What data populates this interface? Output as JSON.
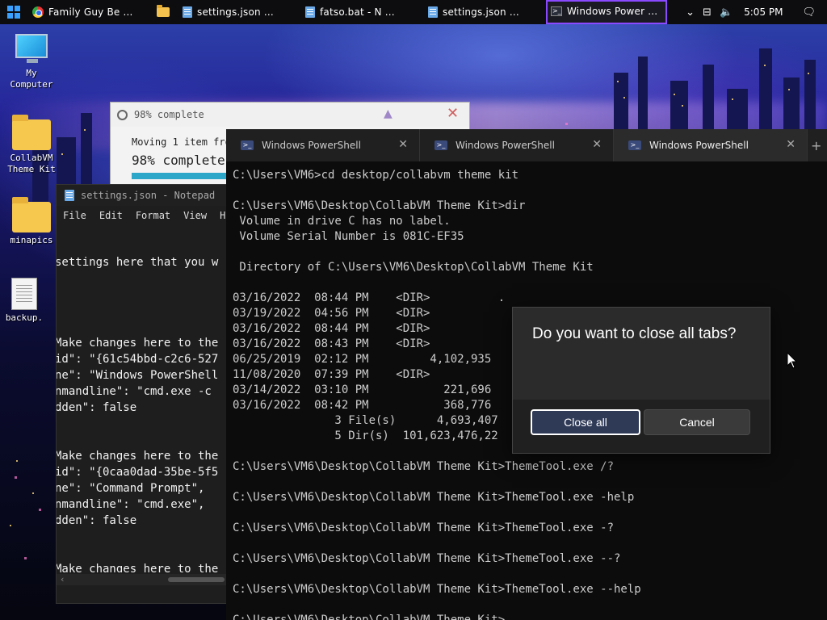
{
  "taskbar": {
    "items": [
      {
        "label": "Family Guy Be ...",
        "icon": "chrome-icon"
      },
      {
        "label": "",
        "icon": "file-explorer-icon"
      },
      {
        "label": "settings.json ...",
        "icon": "notepad-icon"
      },
      {
        "label": "fatso.bat - N ...",
        "icon": "notepad-icon"
      },
      {
        "label": "settings.json ...",
        "icon": "notepad-icon"
      },
      {
        "label": "Windows Power ...",
        "icon": "powershell-icon",
        "active": true
      }
    ],
    "tray": {
      "overflow": "⌄",
      "clock": "5:05 PM"
    }
  },
  "desktop": {
    "icons": [
      {
        "label_lines": [
          "My",
          "Computer"
        ],
        "icon": "my-computer-icon"
      },
      {
        "label_lines": [
          "CollabVM",
          "Theme Kit"
        ],
        "icon": "folder-icon"
      },
      {
        "label_lines": [
          "minapics"
        ],
        "icon": "folder-icon"
      },
      {
        "label_lines": [
          "backup."
        ],
        "icon": "text-file-icon"
      }
    ]
  },
  "progress": {
    "title": "98% complete",
    "moving_text": "Moving 1 item fro",
    "percent_text": "98% complete",
    "progress": 0.98
  },
  "notepad": {
    "title": "settings.json - Notepad",
    "menu": [
      "File",
      "Edit",
      "Format",
      "View",
      "Hel"
    ],
    "lines": [
      "settings here that you w",
      "Make changes here to the",
      "id\": \"{61c54bbd-c2c6-527",
      "ne\": \"Windows PowerShell",
      "nmandline\": \"cmd.exe -c",
      "dden\": false",
      "Make changes here to the",
      "id\": \"{0caa0dad-35be-5f5",
      "ne\": \"Command Prompt\",",
      "nmandline\": \"cmd.exe\",",
      "dden\": false",
      "Make changes here to the"
    ]
  },
  "terminal": {
    "tabs": [
      {
        "label": "Windows PowerShell"
      },
      {
        "label": "Windows PowerShell"
      },
      {
        "label": "Windows PowerShell",
        "selected": true
      }
    ],
    "lines": [
      "C:\\Users\\VM6>cd desktop/collabvm theme kit",
      "",
      "C:\\Users\\VM6\\Desktop\\CollabVM Theme Kit>dir",
      " Volume in drive C has no label.",
      " Volume Serial Number is 081C-EF35",
      "",
      " Directory of C:\\Users\\VM6\\Desktop\\CollabVM Theme Kit",
      "",
      "03/16/2022  08:44 PM    <DIR>          .",
      "03/19/2022  04:56 PM    <DIR>",
      "03/16/2022  08:44 PM    <DIR>",
      "03/16/2022  08:43 PM    <DIR>",
      "06/25/2019  02:12 PM         4,102,935",
      "11/08/2020  07:39 PM    <DIR>",
      "03/14/2022  03:10 PM           221,696",
      "03/16/2022  08:42 PM           368,776",
      "               3 File(s)      4,693,407",
      "               5 Dir(s)  101,623,476,22",
      "",
      "C:\\Users\\VM6\\Desktop\\CollabVM Theme Kit>ThemeTool.exe /?",
      "",
      "C:\\Users\\VM6\\Desktop\\CollabVM Theme Kit>ThemeTool.exe -help",
      "",
      "C:\\Users\\VM6\\Desktop\\CollabVM Theme Kit>ThemeTool.exe -?",
      "",
      "C:\\Users\\VM6\\Desktop\\CollabVM Theme Kit>ThemeTool.exe --?",
      "",
      "C:\\Users\\VM6\\Desktop\\CollabVM Theme Kit>ThemeTool.exe --help",
      "",
      "C:\\Users\\VM6\\Desktop\\CollabVM Theme Kit>"
    ]
  },
  "dialog": {
    "question": "Do you want to close all tabs?",
    "confirm_label": "Close all",
    "cancel_label": "Cancel"
  },
  "colors": {
    "taskbar_active_outline": "#8a48ff",
    "dialog_primary": "#2f3a57",
    "progress_fill": "#2ca6c9"
  }
}
